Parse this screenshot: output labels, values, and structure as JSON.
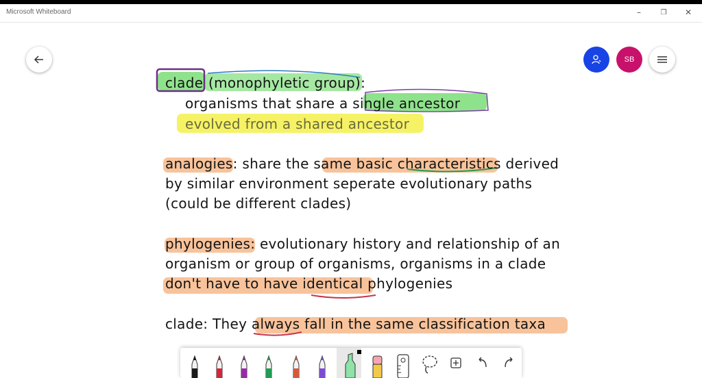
{
  "window": {
    "title": "Microsoft Whiteboard",
    "controls": {
      "minimize": "–",
      "restore": "❐",
      "close": "✕"
    }
  },
  "header": {
    "avatar_initials": "SB"
  },
  "board": {
    "lines": [
      {
        "id": "l1a",
        "text": "clade"
      },
      {
        "id": "l1b",
        "text": "(monophyletic group):"
      },
      {
        "id": "l2",
        "text": "organisms that share a single ancestor"
      },
      {
        "id": "l3",
        "text": "evolved from a shared ancestor"
      },
      {
        "id": "l4",
        "text": "analogies: share the same basic characteristics derived"
      },
      {
        "id": "l5",
        "text": "by similar environment seperate evolutionary paths"
      },
      {
        "id": "l6",
        "text": "(could be different clades)"
      },
      {
        "id": "l7",
        "text": "phylogenies: evolutionary history and relationship of an"
      },
      {
        "id": "l8",
        "text": "organism or group of organisms, organisms in a clade"
      },
      {
        "id": "l9",
        "text": "don't have to have identical phylogenies"
      },
      {
        "id": "l10",
        "text": "clade: They always fall in the same classification taxa"
      }
    ]
  },
  "colors": {
    "green_highlight": "#8fe28c",
    "yellow_highlight": "#f4f04a",
    "orange_highlight": "#f7b98a",
    "invite_blue": "#1844e6",
    "avatar_magenta": "#c8116a"
  },
  "toolbar": {
    "tools": [
      {
        "name": "pen-black",
        "color": "#1a1a1a"
      },
      {
        "name": "pen-red",
        "color": "#d3263a"
      },
      {
        "name": "pen-purple",
        "color": "#9b2aa8"
      },
      {
        "name": "pen-green",
        "color": "#1f9d55"
      },
      {
        "name": "pen-rainbow",
        "color": "#d35b3a"
      },
      {
        "name": "pen-violet",
        "color": "#7b4bd6"
      },
      {
        "name": "highlighter",
        "color": "#8fe2a8"
      },
      {
        "name": "eraser",
        "color": "#f3a6b4"
      }
    ]
  }
}
